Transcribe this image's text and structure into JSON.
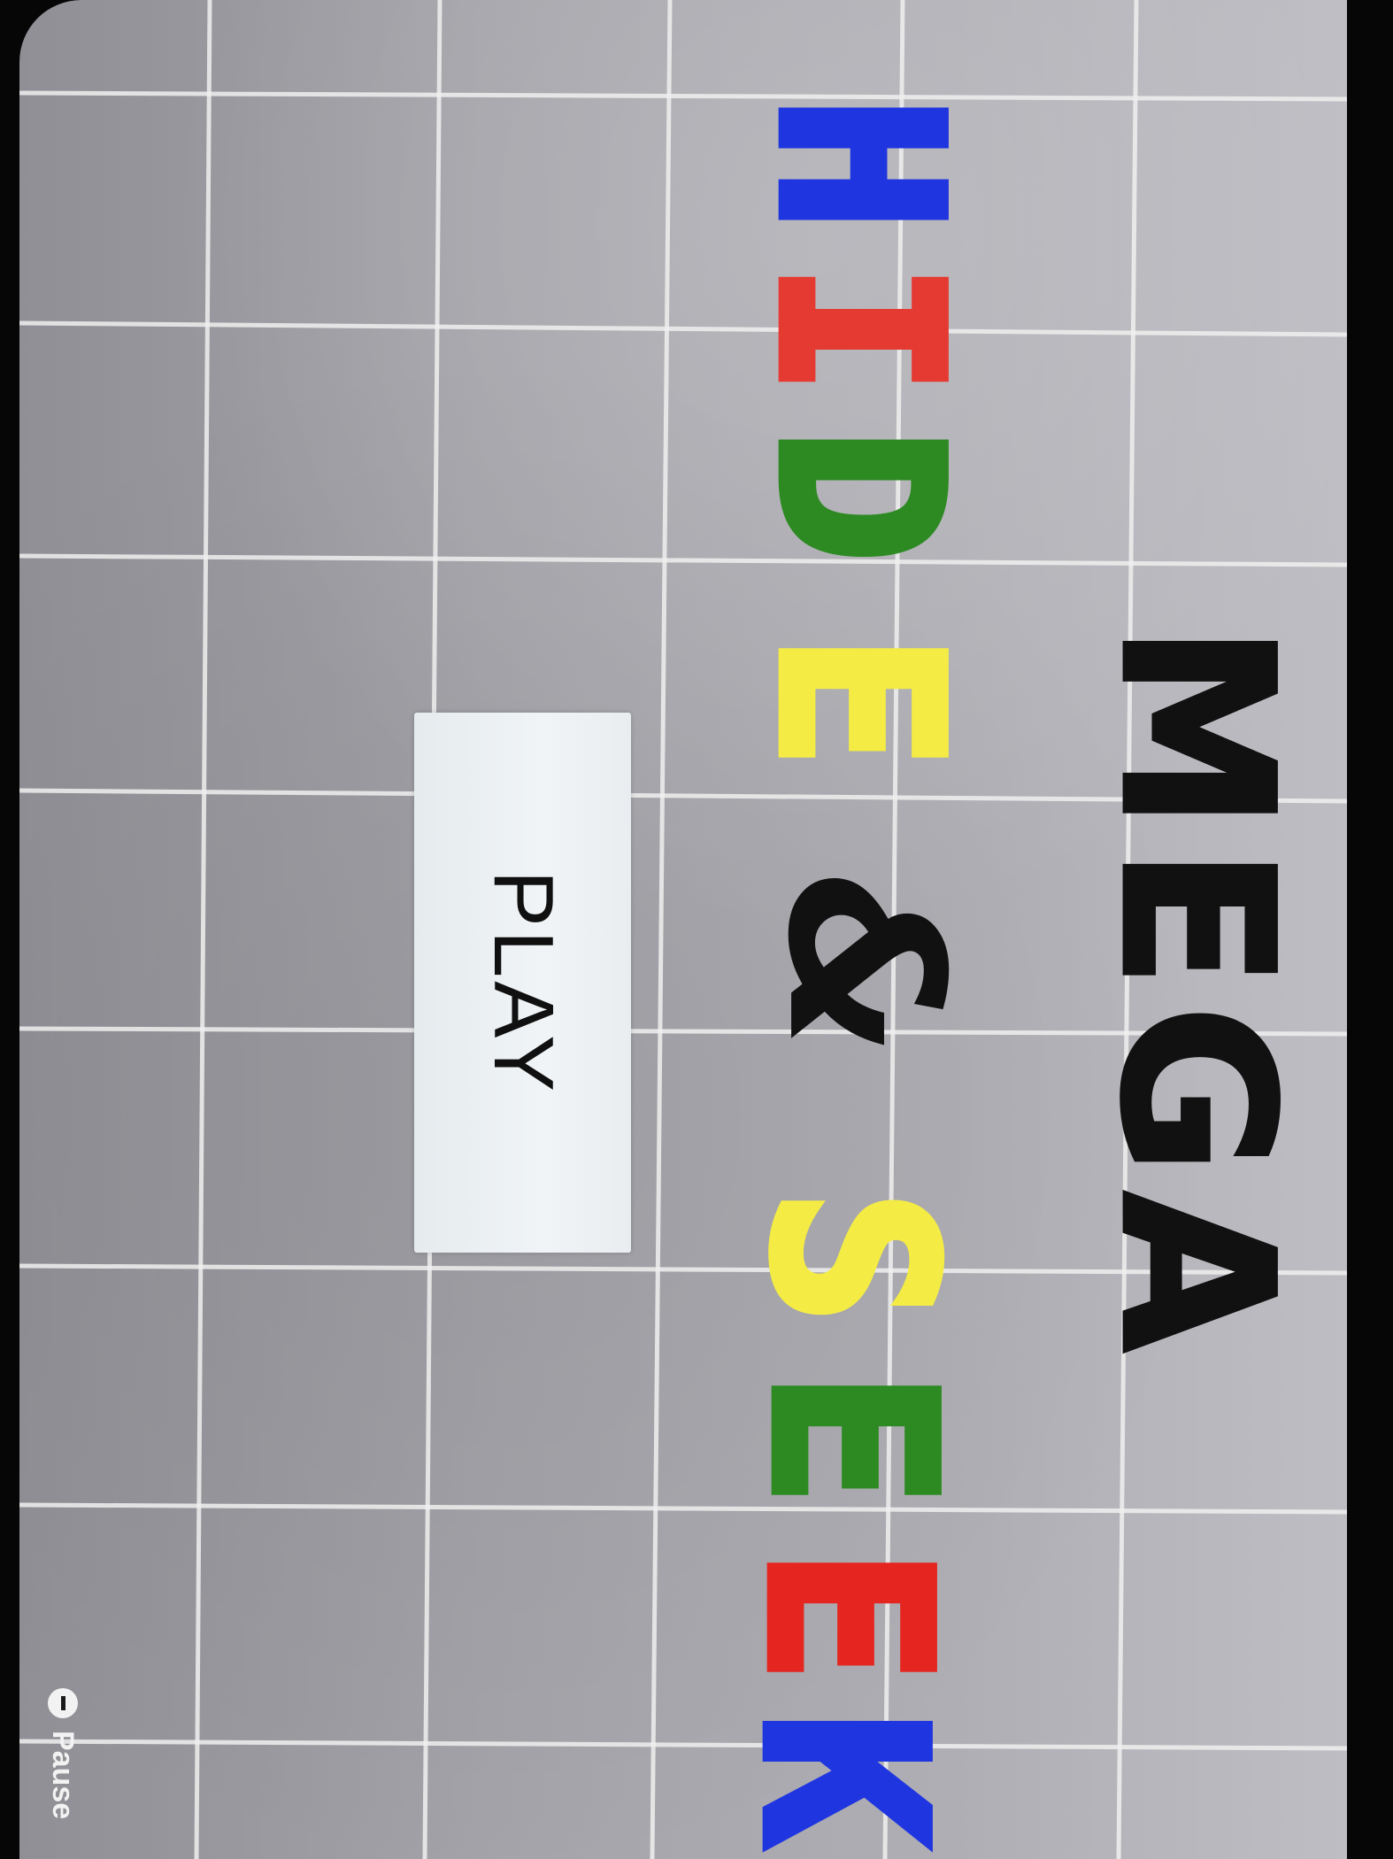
{
  "title": {
    "mega": "MEGA",
    "hide_letters": [
      {
        "char": "H",
        "color": "#1f35e0"
      },
      {
        "char": "I",
        "color": "#e53a32"
      },
      {
        "char": "D",
        "color": "#2d8a22"
      },
      {
        "char": "E",
        "color": "#f4ec45"
      }
    ],
    "ampersand": "&",
    "seek_letters": [
      {
        "char": "S",
        "color": "#f4ec45"
      },
      {
        "char": "E",
        "color": "#2d8a22"
      },
      {
        "char": "E",
        "color": "#e52620"
      },
      {
        "char": "K",
        "color": "#1f35e0"
      }
    ],
    "ink_color": "#111111"
  },
  "menu": {
    "play_label": "PLAY"
  },
  "overlay": {
    "pause_label": "Pause",
    "pause_icon": "pause-circle-icon"
  },
  "colors": {
    "background": "#a8a8ae",
    "grid_line": "#f0f0f0",
    "button_face": "#eef2f4"
  }
}
